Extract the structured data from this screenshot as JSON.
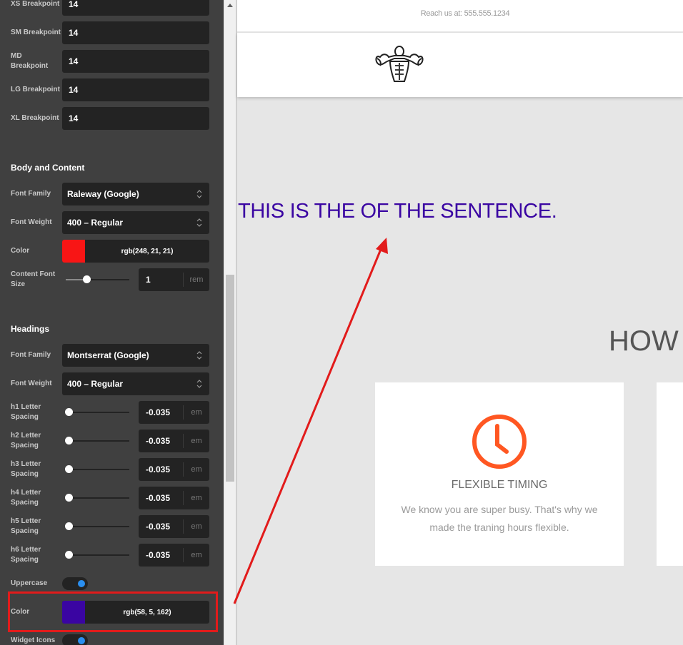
{
  "breakpoints": [
    {
      "label": "XS Breakpoint",
      "value": "14"
    },
    {
      "label": "SM Breakpoint",
      "value": "14"
    },
    {
      "label": "MD Breakpoint",
      "value": "14"
    },
    {
      "label": "LG Breakpoint",
      "value": "14"
    },
    {
      "label": "XL Breakpoint",
      "value": "14"
    }
  ],
  "body": {
    "title": "Body and Content",
    "font_family_label": "Font Family",
    "font_family": "Raleway (Google)",
    "font_weight_label": "Font Weight",
    "font_weight": "400 – Regular",
    "color_label": "Color",
    "color_value": "rgb(248, 21, 21)",
    "color_hex": "#f81515",
    "size_label": "Content Font Size",
    "size_value": "1",
    "size_unit": "rem",
    "size_slider_fraction": 0.33
  },
  "headings": {
    "title": "Headings",
    "font_family_label": "Font Family",
    "font_family": "Montserrat (Google)",
    "font_weight_label": "Font Weight",
    "font_weight": "400 – Regular",
    "spacing": [
      {
        "label": "h1 Letter Spacing",
        "value": "-0.035",
        "unit": "em"
      },
      {
        "label": "h2 Letter Spacing",
        "value": "-0.035",
        "unit": "em"
      },
      {
        "label": "h3 Letter Spacing",
        "value": "-0.035",
        "unit": "em"
      },
      {
        "label": "h4 Letter Spacing",
        "value": "-0.035",
        "unit": "em"
      },
      {
        "label": "h5 Letter Spacing",
        "value": "-0.035",
        "unit": "em"
      },
      {
        "label": "h6 Letter Spacing",
        "value": "-0.035",
        "unit": "em"
      }
    ],
    "uppercase_label": "Uppercase",
    "uppercase_on": true,
    "color_label": "Color",
    "color_value": "rgb(58, 5, 162)",
    "color_hex": "#3a05a2",
    "widget_icons_label": "Widget Icons",
    "widget_icons_on": true
  },
  "preview": {
    "reach_text": "Reach us at: 555.555.1234",
    "headline": "THIS IS THE OF THE SENTENCE.",
    "section_heading": "HOW",
    "card": {
      "title": "FLEXIBLE TIMING",
      "text": "We know you are super busy. That's why we made the traning hours flexible.",
      "icon_color": "#ff5722"
    }
  }
}
